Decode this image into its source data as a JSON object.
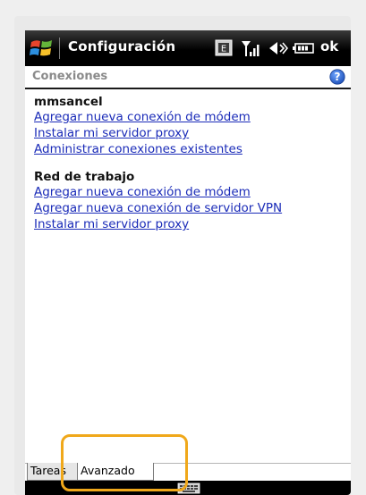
{
  "titlebar": {
    "title": "Configuración",
    "ok_label": "ok",
    "icons": [
      "windows-start-icon",
      "edge-network-icon",
      "signal-icon",
      "volume-icon",
      "battery-icon"
    ]
  },
  "header": {
    "title": "Conexiones",
    "help_icon": "help-icon"
  },
  "groups": [
    {
      "title": "mmsancel",
      "links": [
        "Agregar nueva conexión de módem",
        "Instalar mi servidor proxy",
        "Administrar conexiones existentes"
      ]
    },
    {
      "title": "Red de trabajo",
      "links": [
        "Agregar nueva conexión de módem",
        "Agregar nueva conexión de servidor VPN",
        "Instalar mi servidor proxy"
      ]
    }
  ],
  "tabs": [
    "Tareas",
    "Avanzado"
  ],
  "colors": {
    "link": "#1a2bb8",
    "highlight": "#f0a81a",
    "titlebar": "#000000"
  }
}
